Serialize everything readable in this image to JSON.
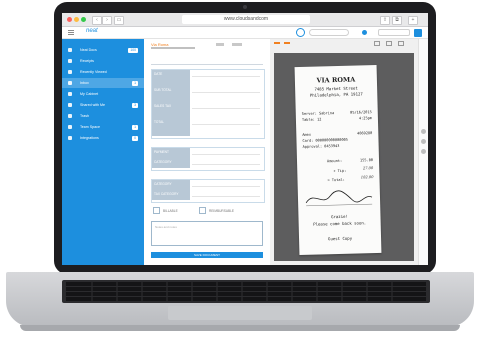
{
  "browser": {
    "url": "www.cloudsandcom"
  },
  "app": {
    "logo": "neat",
    "doc_title": "Via Roma",
    "save_label": "SAVE DOCUMENT"
  },
  "sidebar": {
    "items": [
      {
        "label": "Neat Docs",
        "badge": "100"
      },
      {
        "label": "Receipts",
        "badge": ""
      },
      {
        "label": "Recently Viewed",
        "badge": ""
      },
      {
        "label": "Inbox",
        "badge": "1"
      },
      {
        "label": "My Cabinet",
        "badge": ""
      },
      {
        "label": "Shared with Me",
        "badge": "3"
      },
      {
        "label": "Trash",
        "badge": ""
      },
      {
        "label": "Team Space",
        "badge": "1"
      },
      {
        "label": "Integrations",
        "badge": "0"
      }
    ]
  },
  "form": {
    "fields_a": [
      "DATE",
      "SUB TOTAL",
      "SALES TAX",
      "TOTAL"
    ],
    "values_a": [
      "",
      "",
      "",
      ""
    ],
    "fields_b": [
      "PAYMENT",
      "CATEGORY"
    ],
    "fields_c": [
      "CATEGORY",
      "TAX CATEGORY"
    ],
    "checkboxes": [
      "BILLABLE",
      "REIMBURSABLE"
    ],
    "notes_placeholder": "Notes and notes"
  },
  "receipt": {
    "name": "VIA ROMA",
    "address1": "7485 Market Street",
    "address2": "Philadelphia, PA 19127",
    "line1_left": "Server: Sabrina",
    "line1_right": "05/16/2015",
    "line2_left": "Table: 12",
    "line2_right": "4:25pm",
    "line3_left": "Amex",
    "line3_right": "4869280",
    "line4_left": "Card: 000000000000005",
    "line5_left": "Approval: 0453943",
    "amount_label": "Amount:",
    "amount_value": "155.00",
    "tip_label": "+ Tip:",
    "tip_value": "27.00",
    "total_label": "= Total:",
    "total_value": "182.00",
    "thanks": "Grazie!",
    "thanks2": "Please come back soon.",
    "footer": "Guest Copy"
  },
  "colors": {
    "accent": "#1d8fde",
    "group_header": "#b8c8d6",
    "orange": "#f08020"
  }
}
